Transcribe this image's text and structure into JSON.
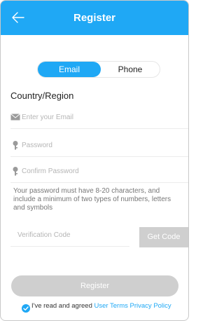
{
  "header": {
    "title": "Register",
    "back_icon": "arrow-left-icon"
  },
  "tabs": [
    {
      "label": "Email",
      "active": true
    },
    {
      "label": "Phone",
      "active": false
    }
  ],
  "country_label": "Country/Region",
  "fields": {
    "email": {
      "placeholder": "Enter your Email",
      "icon": "envelope-icon",
      "value": ""
    },
    "password": {
      "placeholder": "Password",
      "icon": "key-icon",
      "value": ""
    },
    "confirm_password": {
      "placeholder": "Confirm Password",
      "icon": "key-icon",
      "value": ""
    }
  },
  "password_hint": "Your password must have 8-20 characters, and include a minimum of two types of numbers, letters and symbols",
  "verification": {
    "placeholder": "Verification Code",
    "value": "",
    "get_code_label": "Get Code"
  },
  "register_label": "Register",
  "agreement": {
    "prefix": "I've read and agreed",
    "user_terms": "User Terms",
    "privacy_policy": "Privacy Policy",
    "checked": true
  },
  "colors": {
    "accent": "#1fa8f5",
    "disabled": "#cfcfcf"
  }
}
